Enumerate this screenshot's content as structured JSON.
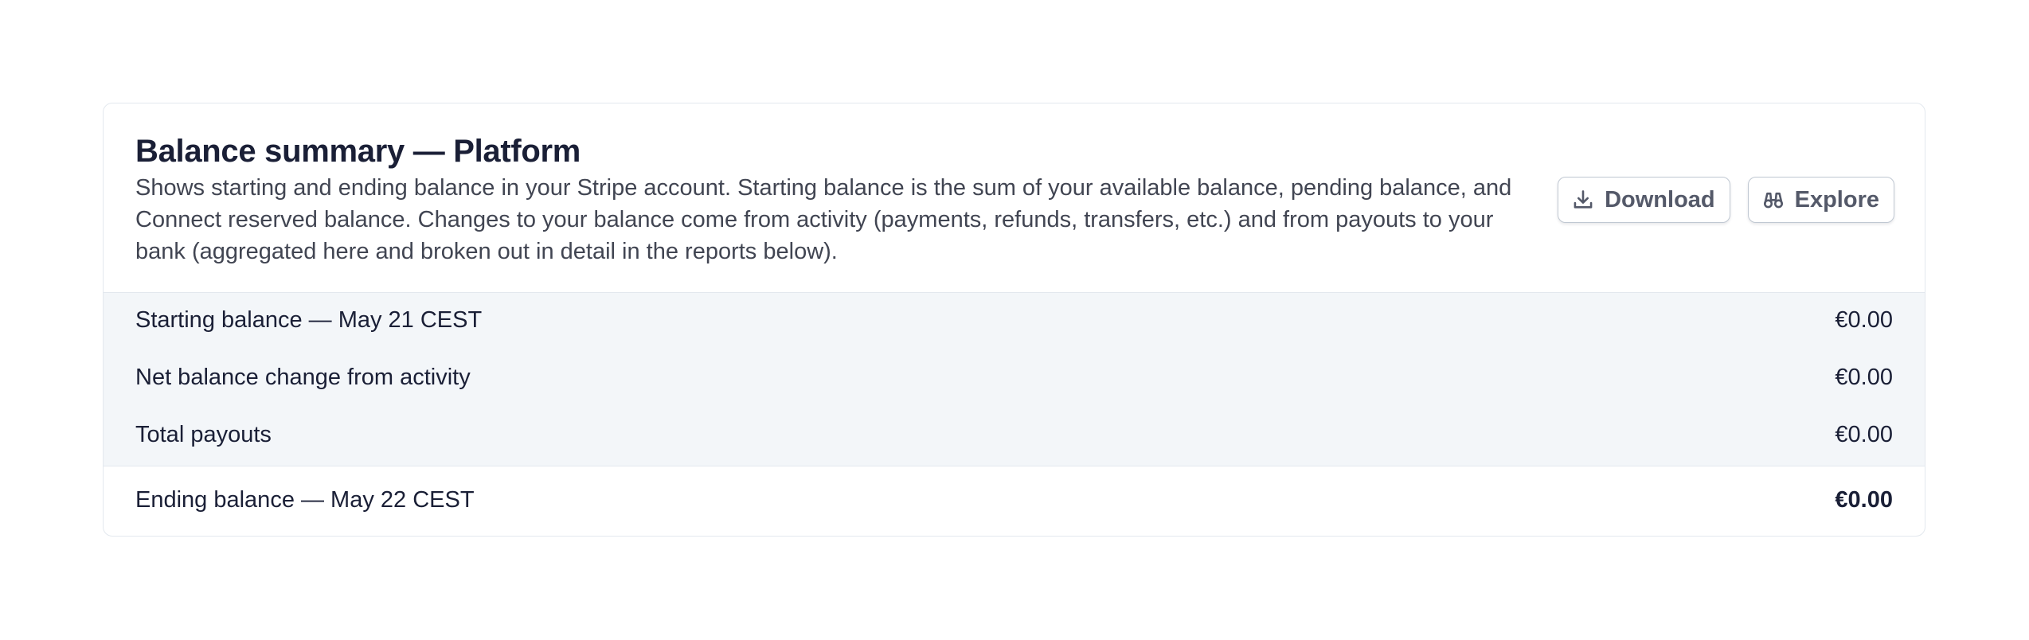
{
  "summary": {
    "title": "Balance summary — Platform",
    "description": "Shows starting and ending balance in your Stripe account. Starting balance is the sum of your available balance, pending balance, and Connect reserved balance. Changes to your balance come from activity (payments, refunds, transfers, etc.) and from payouts to your bank (aggregated here and broken out in detail in the reports below).",
    "actions": {
      "download_label": "Download",
      "download_icon": "download-icon",
      "explore_label": "Explore",
      "explore_icon": "binoculars-icon"
    },
    "rows": [
      {
        "label": "Starting balance — May 21 CEST",
        "amount": "€0.00"
      },
      {
        "label": "Net balance change from activity",
        "amount": "€0.00"
      },
      {
        "label": "Total payouts",
        "amount": "€0.00"
      }
    ],
    "ending": {
      "label": "Ending balance — May 22 CEST",
      "amount": "€0.00"
    }
  },
  "colors": {
    "row_background": "#f3f6f9",
    "border": "#e3e8ee",
    "text_primary": "#1a1f36",
    "text_secondary": "#414552",
    "button_text": "#545969"
  }
}
